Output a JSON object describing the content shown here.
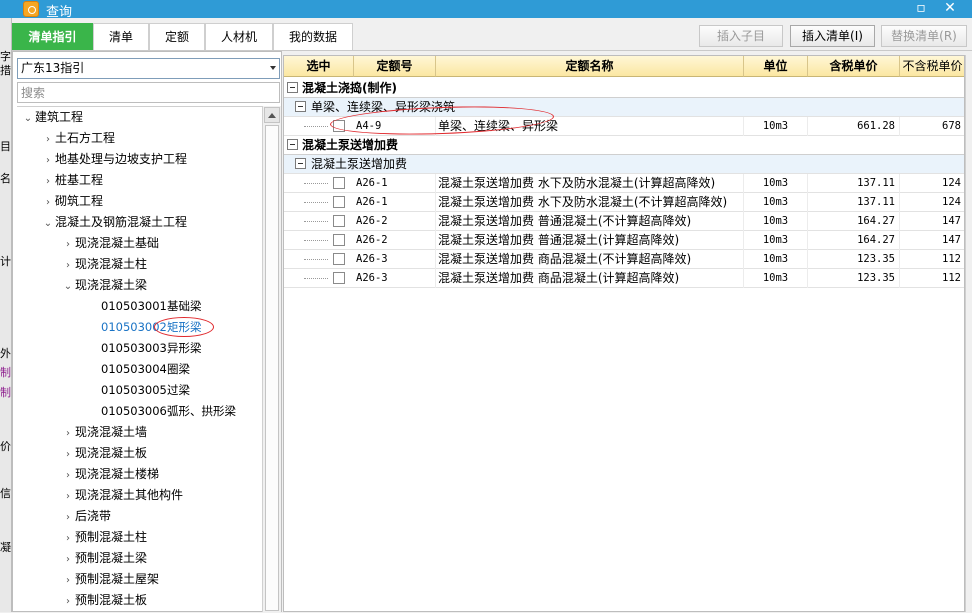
{
  "window": {
    "title": "查询",
    "controls": {
      "maximize": "▫",
      "close": "✕"
    }
  },
  "background_strip": [
    "字",
    "措",
    "目",
    "名",
    "计",
    "外垄",
    "制价",
    "制价",
    "价",
    "信息",
    "凝土"
  ],
  "tabs": [
    {
      "label": "清单指引",
      "active": true
    },
    {
      "label": "清单",
      "active": false
    },
    {
      "label": "定额",
      "active": false
    },
    {
      "label": "人材机",
      "active": false
    },
    {
      "label": "我的数据",
      "active": false
    }
  ],
  "toolbar": {
    "insert_child": "插入子目",
    "insert_list": "插入清单(I)",
    "replace_list": "替换清单(R)"
  },
  "left": {
    "library_select": "广东13指引",
    "search_placeholder": "搜索",
    "tree": [
      {
        "label": "建筑工程",
        "toggle": "⌄",
        "level": 0
      },
      {
        "label": "土石方工程",
        "toggle": "›",
        "level": 1
      },
      {
        "label": "地基处理与边坡支护工程",
        "toggle": "›",
        "level": 1
      },
      {
        "label": "桩基工程",
        "toggle": "›",
        "level": 1
      },
      {
        "label": "砌筑工程",
        "toggle": "›",
        "level": 1
      },
      {
        "label": "混凝土及钢筋混凝土工程",
        "toggle": "⌄",
        "level": 1
      },
      {
        "label": "现浇混凝土基础",
        "toggle": "›",
        "level": 2
      },
      {
        "label": "现浇混凝土柱",
        "toggle": "›",
        "level": 2
      },
      {
        "label": "现浇混凝土梁",
        "toggle": "⌄",
        "level": 2
      },
      {
        "code": "010503001",
        "label": "基础梁",
        "level": 3
      },
      {
        "code": "010503002",
        "label": "矩形梁",
        "level": 3,
        "selected": true
      },
      {
        "code": "010503003",
        "label": "异形梁",
        "level": 3
      },
      {
        "code": "010503004",
        "label": "圈梁",
        "level": 3
      },
      {
        "code": "010503005",
        "label": "过梁",
        "level": 3
      },
      {
        "code": "010503006",
        "label": "弧形、拱形梁",
        "level": 3
      },
      {
        "label": "现浇混凝土墙",
        "toggle": "›",
        "level": 2
      },
      {
        "label": "现浇混凝土板",
        "toggle": "›",
        "level": 2
      },
      {
        "label": "现浇混凝土楼梯",
        "toggle": "›",
        "level": 2
      },
      {
        "label": "现浇混凝土其他构件",
        "toggle": "›",
        "level": 2
      },
      {
        "label": "后浇带",
        "toggle": "›",
        "level": 2
      },
      {
        "label": "预制混凝土柱",
        "toggle": "›",
        "level": 2
      },
      {
        "label": "预制混凝土梁",
        "toggle": "›",
        "level": 2
      },
      {
        "label": "预制混凝土屋架",
        "toggle": "›",
        "level": 2
      },
      {
        "label": "预制混凝土板",
        "toggle": "›",
        "level": 2
      }
    ]
  },
  "grid": {
    "columns": [
      "选中",
      "定额号",
      "定额名称",
      "单位",
      "含税单价",
      "不含税单价"
    ],
    "groups": [
      {
        "title": "混凝土浇捣(制作)",
        "subgroups": [
          {
            "title": "单梁、连续梁、异形梁浇筑",
            "rows": [
              {
                "code": "A4-9",
                "name": "单梁、连续梁、异形梁",
                "unit": "10m3",
                "price_tax": "661.28",
                "price_notax": "678"
              }
            ]
          }
        ]
      },
      {
        "title": "混凝土泵送增加费",
        "subgroups": [
          {
            "title": "混凝土泵送增加费",
            "rows": [
              {
                "code": "A26-1",
                "name": "混凝土泵送增加费 水下及防水混凝土(计算超高降效)",
                "unit": "10m3",
                "price_tax": "137.11",
                "price_notax": "124"
              },
              {
                "code": "A26-1",
                "name": "混凝土泵送增加费 水下及防水混凝土(不计算超高降效)",
                "unit": "10m3",
                "price_tax": "137.11",
                "price_notax": "124"
              },
              {
                "code": "A26-2",
                "name": "混凝土泵送增加费 普通混凝土(不计算超高降效)",
                "unit": "10m3",
                "price_tax": "164.27",
                "price_notax": "147"
              },
              {
                "code": "A26-2",
                "name": "混凝土泵送增加费 普通混凝土(计算超高降效)",
                "unit": "10m3",
                "price_tax": "164.27",
                "price_notax": "147"
              },
              {
                "code": "A26-3",
                "name": "混凝土泵送增加费 商品混凝土(不计算超高降效)",
                "unit": "10m3",
                "price_tax": "123.35",
                "price_notax": "112"
              },
              {
                "code": "A26-3",
                "name": "混凝土泵送增加费 商品混凝土(计算超高降效)",
                "unit": "10m3",
                "price_tax": "123.35",
                "price_notax": "112"
              }
            ]
          }
        ]
      }
    ]
  },
  "colors": {
    "titlebar": "#2f9bd6",
    "active_tab": "#3ab54a",
    "header": "#fbe7a2",
    "annotation": "#e0282c",
    "selected_text": "#1a73c5"
  }
}
